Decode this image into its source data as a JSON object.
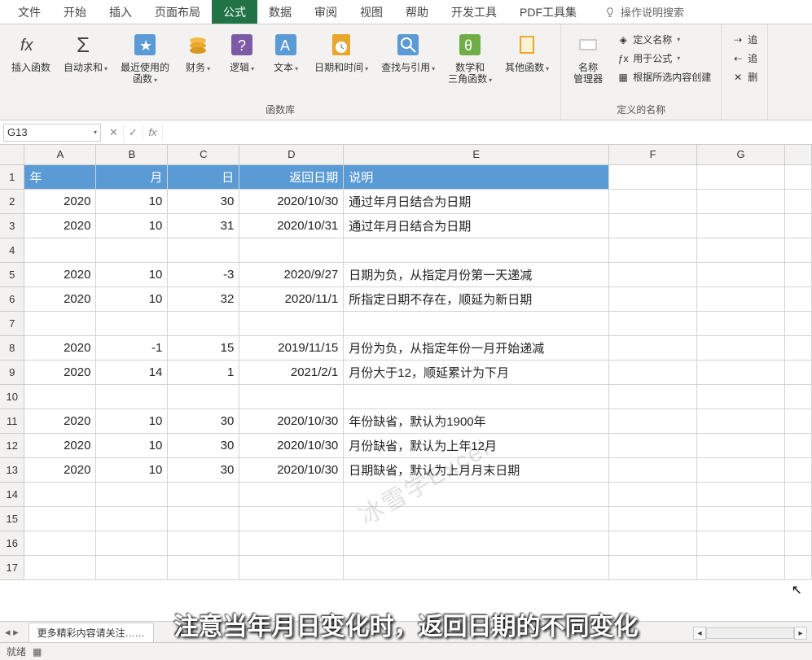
{
  "tabs": {
    "file": "文件",
    "home": "开始",
    "insert": "插入",
    "layout": "页面布局",
    "formulas": "公式",
    "data": "数据",
    "review": "审阅",
    "view": "视图",
    "help": "帮助",
    "dev": "开发工具",
    "pdf": "PDF工具集",
    "tellme": "操作说明搜索"
  },
  "ribbon": {
    "insert_fn": "插入函数",
    "autosum": "自动求和",
    "recent": "最近使用的\n函数",
    "finance": "财务",
    "logic": "逻辑",
    "text": "文本",
    "datetime": "日期和时间",
    "lookup": "查找与引用",
    "math": "数学和\n三角函数",
    "other": "其他函数",
    "group_lib": "函数库",
    "name_mgr": "名称\n管理器",
    "def_name": "定义名称",
    "use_fml": "用于公式",
    "from_sel": "根据所选内容创建",
    "group_names": "定义的名称",
    "trace": "追",
    "trace2": "追",
    "remove": "删"
  },
  "namebox": "G13",
  "headers": {
    "A": "年",
    "B": "月",
    "C": "日",
    "D": "返回日期",
    "E": "说明"
  },
  "rows": [
    {
      "r": 2,
      "A": "2020",
      "B": "10",
      "C": "30",
      "D": "2020/10/30",
      "E": "通过年月日结合为日期"
    },
    {
      "r": 3,
      "A": "2020",
      "B": "10",
      "C": "31",
      "D": "2020/10/31",
      "E": "通过年月日结合为日期"
    },
    {
      "r": 4
    },
    {
      "r": 5,
      "A": "2020",
      "B": "10",
      "C": "-3",
      "D": "2020/9/27",
      "E": "日期为负，从指定月份第一天递减"
    },
    {
      "r": 6,
      "A": "2020",
      "B": "10",
      "C": "32",
      "D": "2020/11/1",
      "E": "所指定日期不存在，顺延为新日期"
    },
    {
      "r": 7
    },
    {
      "r": 8,
      "A": "2020",
      "B": "-1",
      "C": "15",
      "D": "2019/11/15",
      "E": "月份为负，从指定年份一月开始递减"
    },
    {
      "r": 9,
      "A": "2020",
      "B": "14",
      "C": "1",
      "D": "2021/2/1",
      "E": "月份大于12，顺延累计为下月"
    },
    {
      "r": 10
    },
    {
      "r": 11,
      "A": "2020",
      "B": "10",
      "C": "30",
      "D": "2020/10/30",
      "E": "年份缺省，默认为1900年"
    },
    {
      "r": 12,
      "A": "2020",
      "B": "10",
      "C": "30",
      "D": "2020/10/30",
      "E": "月份缺省，默认为上年12月"
    },
    {
      "r": 13,
      "A": "2020",
      "B": "10",
      "C": "30",
      "D": "2020/10/30",
      "E": "日期缺省，默认为上月月末日期"
    }
  ],
  "empty_rows": [
    14,
    15,
    16,
    17
  ],
  "sheet_tab": "更多精彩内容请关注……",
  "status": "就绪",
  "caption": "注意当年月日变化时，返回日期的不同变化",
  "watermark": "冰雪学Excel",
  "cols": {
    "A": "A",
    "B": "B",
    "C": "C",
    "D": "D",
    "E": "E",
    "F": "F",
    "G": "G"
  }
}
